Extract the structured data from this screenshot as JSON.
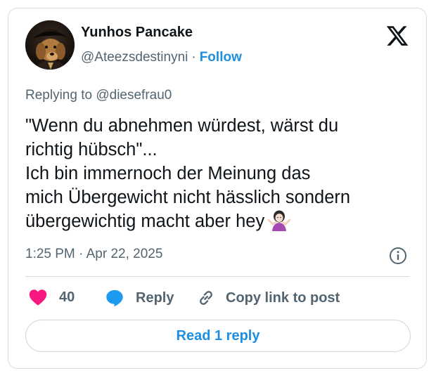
{
  "author": {
    "name": "Yunhos Pancake",
    "handle": "@Ateezsdestinyni",
    "separator": "·",
    "follow_label": "Follow",
    "avatar_icon": "dog-in-pirate-hat-avatar"
  },
  "platform_icon": "x-logo-icon",
  "replying": {
    "prefix": "Replying to ",
    "handle": "@diesefrau0"
  },
  "tweet": {
    "text": "\"Wenn du abnehmen würdest, wärst du\nrichtig hübsch\"...\nIch bin immernoch der Meinung das\nmich Übergewicht nicht hässlich sondern\nübergewichtig macht aber hey",
    "emoji": "woman-shrugging-emoji"
  },
  "meta": {
    "timestamp": "1:25 PM · Apr 22, 2025",
    "info_icon": "info-icon"
  },
  "actions": {
    "like_count": "40",
    "reply_label": "Reply",
    "copy_label": "Copy link to post"
  },
  "read_replies_label": "Read 1 reply",
  "colors": {
    "accent": "#1d8fe0",
    "like": "#f91880",
    "reply_bubble": "#1d9bf0",
    "muted": "#536471",
    "border": "#d6dbe0"
  }
}
